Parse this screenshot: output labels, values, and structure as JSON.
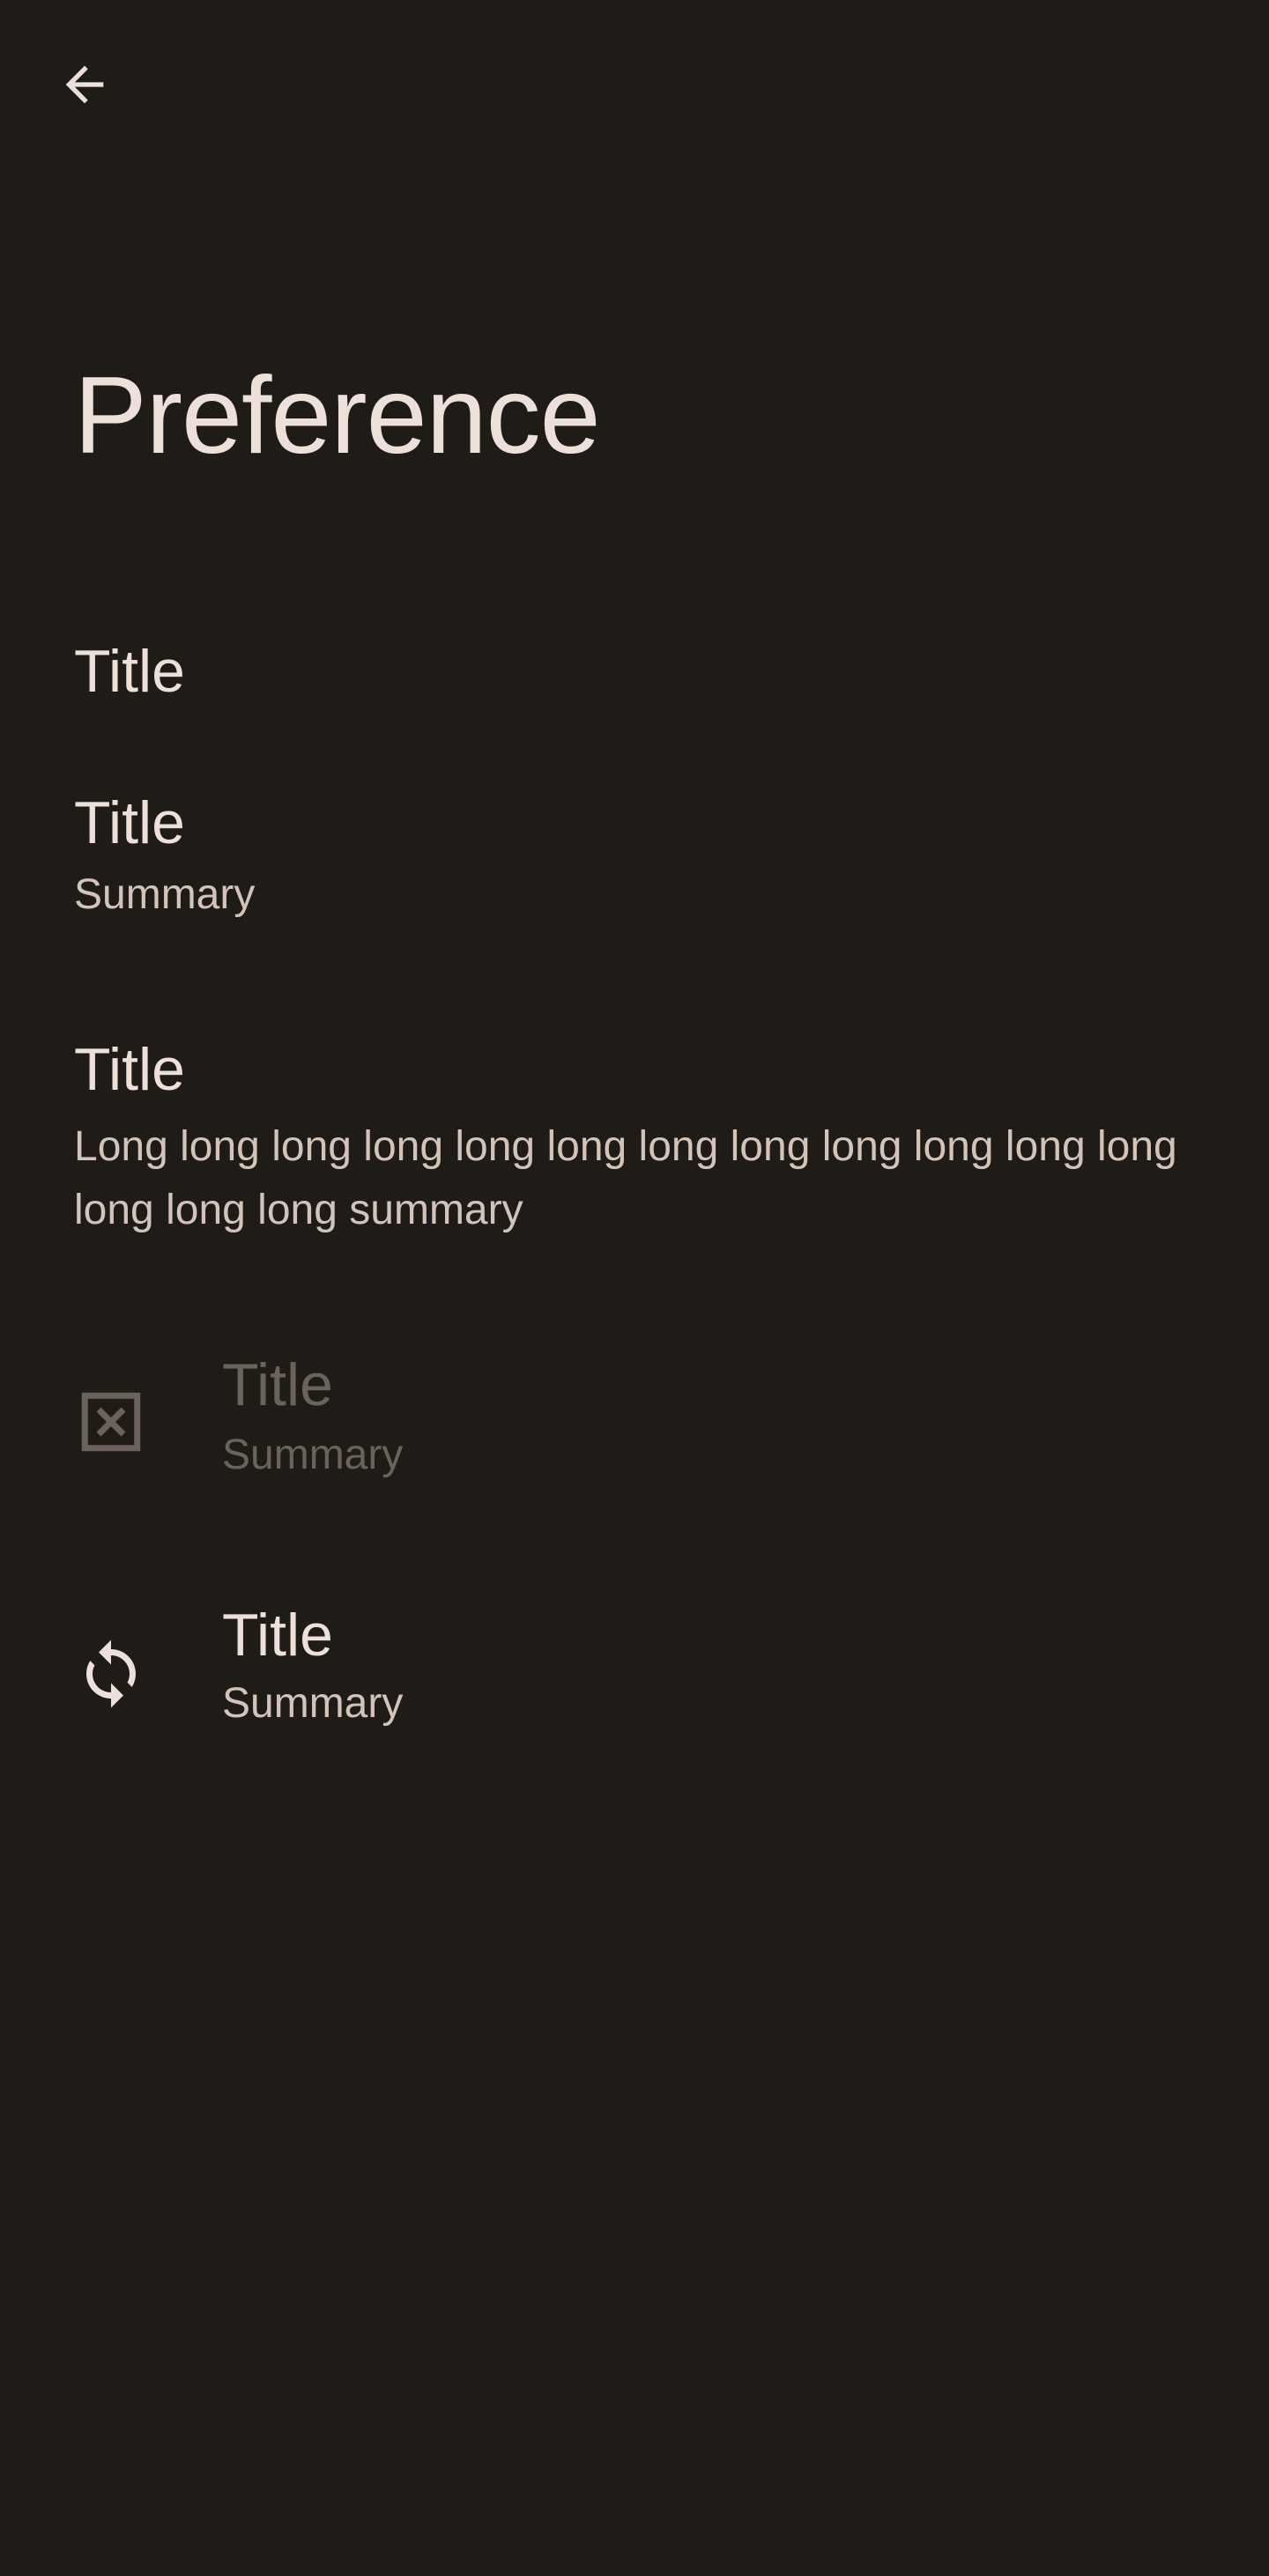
{
  "toolbar": {
    "back_icon": "arrow-back-icon"
  },
  "page": {
    "title": "Preference"
  },
  "preferences": [
    {
      "title": "Title",
      "summary": "",
      "icon": "",
      "enabled": true
    },
    {
      "title": "Title",
      "summary": "Summary",
      "icon": "",
      "enabled": true
    },
    {
      "title": "Title",
      "summary": "Long long long long long long long long long long long long long long long summary",
      "icon": "",
      "enabled": true
    },
    {
      "title": "Title",
      "summary": "Summary",
      "icon": "disabled-box-icon",
      "enabled": false
    },
    {
      "title": "Title",
      "summary": "Summary",
      "icon": "sync-icon",
      "enabled": true
    }
  ],
  "colors": {
    "background": "#1f1b17",
    "text_primary": "#ece0d8",
    "text_secondary": "#d3c4b9",
    "text_disabled": "#6a625b"
  }
}
